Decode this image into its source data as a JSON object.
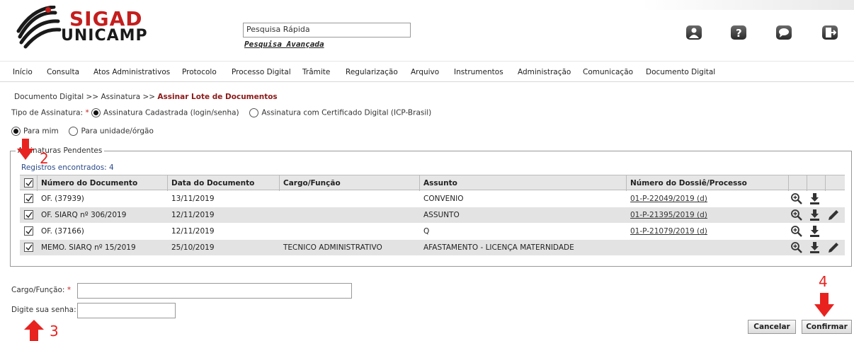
{
  "app": {
    "logo_top": "SIGAD",
    "logo_bottom": "UNICAMP",
    "quick_search_value": "Pesquisa Rápida",
    "advanced_search_label": "Pesquisa Avançada",
    "toolbar_icons": [
      "user-icon",
      "help-icon",
      "chat-icon",
      "exit-icon"
    ]
  },
  "menu": [
    "Início",
    "Consulta",
    "Atos Administrativos",
    "Protocolo",
    "Processo Digital",
    "Trâmite",
    "Regularização",
    "Arquivo",
    "Instrumentos",
    "Administração",
    "Comunicação",
    "Documento Digital"
  ],
  "breadcrumb": {
    "path": "Documento Digital >> Assinatura >> ",
    "current": "Assinar Lote de Documentos"
  },
  "signature_type": {
    "label": "Tipo de Assinatura:",
    "required_mark": "*",
    "option1": "Assinatura Cadastrada (login/senha)",
    "option2": "Assinatura com Certificado Digital (ICP-Brasil)",
    "selected": "option1"
  },
  "target": {
    "option1": "Para mim",
    "option2": "Para unidade/órgão",
    "selected": "option1"
  },
  "pending": {
    "legend": "Assinaturas Pendentes",
    "found": "Registros encontrados: 4",
    "columns": [
      "Número do Documento",
      "Data do Documento",
      "Cargo/Função",
      "Assunto",
      "Número do Dossiê/Processo"
    ],
    "rows": [
      {
        "numero": "OF. (37939)",
        "data": "13/11/2019",
        "cargo": "",
        "assunto": "CONVENIO",
        "processo_a": "01-P-22049",
        "processo_b": "/2019 (d)",
        "actions": [
          "zoom-icon",
          "download-icon"
        ]
      },
      {
        "numero": "OF. SIARQ nº 306/2019",
        "data": "12/11/2019",
        "cargo": "",
        "assunto": "ASSUNTO",
        "processo_a": "01-P-21395",
        "processo_b": "/2019 (d)",
        "actions": [
          "zoom-icon",
          "download-icon",
          "edit-icon"
        ]
      },
      {
        "numero": "OF. (37166)",
        "data": "12/11/2019",
        "cargo": "",
        "assunto": "Q",
        "processo_a": "01-P-21079",
        "processo_b": "/2019 (d)",
        "actions": [
          "zoom-icon",
          "download-icon"
        ]
      },
      {
        "numero": "MEMO. SIARQ nº 15/2019",
        "data": "25/10/2019",
        "cargo": "TECNICO ADMINISTRATIVO",
        "assunto": "AFASTAMENTO - LICENÇA MATERNIDADE",
        "processo_a": "",
        "processo_b": "",
        "actions": [
          "zoom-icon",
          "download-icon",
          "edit-icon"
        ]
      }
    ]
  },
  "form": {
    "cargo_label": "Cargo/Função:",
    "cargo_required": "*",
    "cargo_value": "",
    "senha_label": "Digite sua senha:",
    "senha_value": ""
  },
  "buttons": {
    "cancel": "Cancelar",
    "confirm": "Confirmar"
  },
  "annotations": {
    "n2": "2",
    "n3": "3",
    "n4": "4"
  },
  "colors": {
    "brand_red": "#c41e1e",
    "annotation_red": "#e8231f",
    "crumb_current": "#8a1a1a"
  }
}
